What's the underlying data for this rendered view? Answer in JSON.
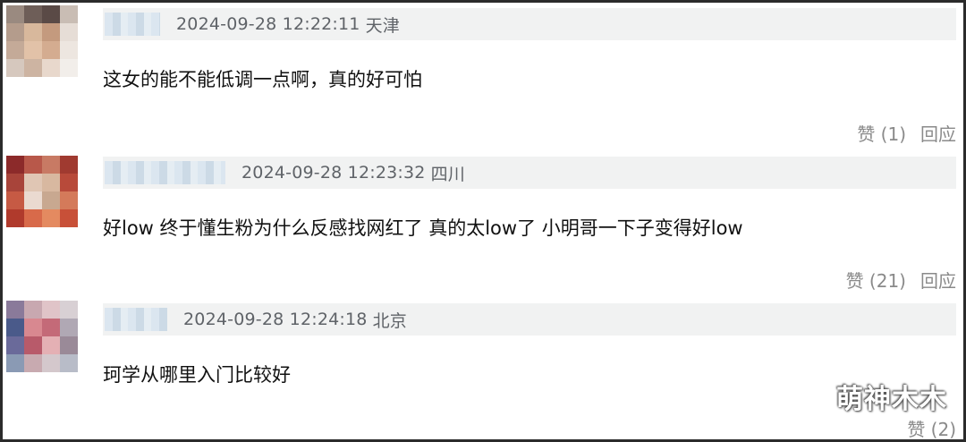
{
  "comments": [
    {
      "timestamp": "2024-09-28 12:22:11",
      "location": "天津",
      "text": "这女的能不能低调一点啊，真的好可怕",
      "like_label": "赞 (1)",
      "reply_label": "回应"
    },
    {
      "timestamp": "2024-09-28 12:23:32",
      "location": "四川",
      "text": "好low 终于懂生粉为什么反感找网红了 真的太low了 小明哥一下子变得好low",
      "like_label": "赞 (21)",
      "reply_label": "回应"
    },
    {
      "timestamp": "2024-09-28 12:24:18",
      "location": "北京",
      "text": "珂学从哪里入门比较好",
      "like_label": "赞 (2)",
      "reply_label": ""
    }
  ],
  "watermark": "萌神木木",
  "colors": {
    "meta_bg": "#f1f2f2",
    "meta_text": "#5f6368",
    "action_text": "#8a8a8a",
    "border": "#2b2b2b"
  }
}
